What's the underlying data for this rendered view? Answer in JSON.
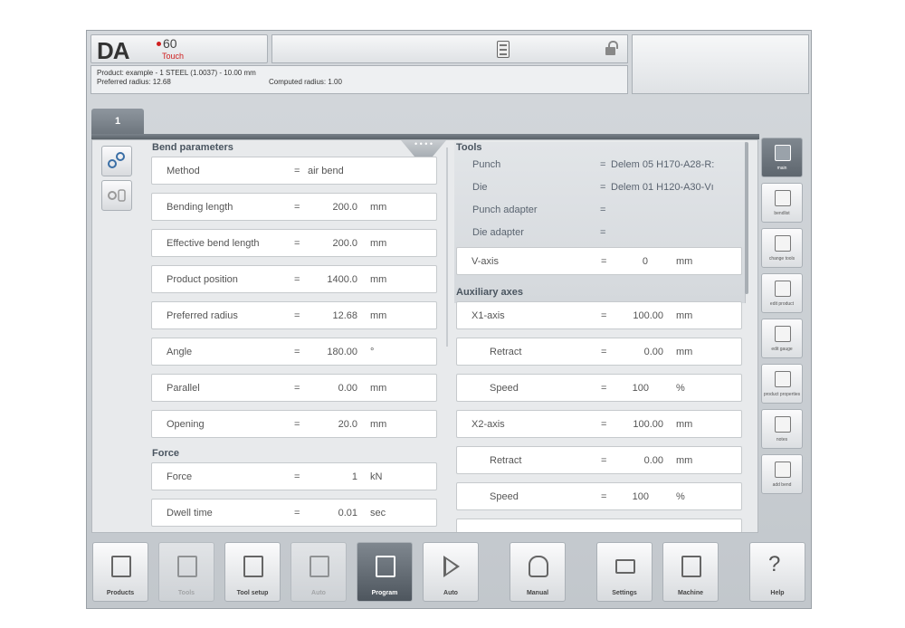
{
  "header": {
    "logo_brand": "DA",
    "logo_model": "60",
    "logo_touch": "Touch",
    "product_line": "Product: example - 1 STEEL (1.0037) - 10.00 mm",
    "preferred_radius": "Preferred radius: 12.68",
    "computed_radius": "Computed radius: 1.00"
  },
  "tab": {
    "label": "1"
  },
  "bend": {
    "title": "Bend parameters",
    "rows": [
      {
        "label": "Method",
        "eq": "=",
        "value": "air bend",
        "unit": ""
      },
      {
        "label": "Bending length",
        "eq": "=",
        "value": "200.0",
        "unit": "mm"
      },
      {
        "label": "Effective bend length",
        "eq": "=",
        "value": "200.0",
        "unit": "mm"
      },
      {
        "label": "Product position",
        "eq": "=",
        "value": "1400.0",
        "unit": "mm"
      },
      {
        "label": "Preferred radius",
        "eq": "=",
        "value": "12.68",
        "unit": "mm"
      },
      {
        "label": "Angle",
        "eq": "=",
        "value": "180.00",
        "unit": "°"
      },
      {
        "label": "Parallel",
        "eq": "=",
        "value": "0.00",
        "unit": "mm"
      },
      {
        "label": "Opening",
        "eq": "=",
        "value": "20.0",
        "unit": "mm"
      }
    ]
  },
  "force": {
    "title": "Force",
    "rows": [
      {
        "label": "Force",
        "eq": "=",
        "value": "1",
        "unit": "kN"
      },
      {
        "label": "Dwell time",
        "eq": "=",
        "value": "0.01",
        "unit": "sec"
      }
    ]
  },
  "tools": {
    "title": "Tools",
    "rows": [
      {
        "label": "Punch",
        "eq": "=",
        "value": "Delem 05 H170-A28-R:"
      },
      {
        "label": "Die",
        "eq": "=",
        "value": "Delem 01 H120-A30-Vı"
      },
      {
        "label": "Punch adapter",
        "eq": "=",
        "value": ""
      },
      {
        "label": "Die adapter",
        "eq": "=",
        "value": ""
      }
    ],
    "vaxis": {
      "label": "V-axis",
      "eq": "=",
      "value": "0",
      "unit": "mm"
    }
  },
  "aux": {
    "title": "Auxiliary axes",
    "rows": [
      {
        "label": "X1-axis",
        "eq": "=",
        "value": "100.00",
        "unit": "mm"
      },
      {
        "label": "Retract",
        "eq": "=",
        "value": "0.00",
        "unit": "mm"
      },
      {
        "label": "Speed",
        "eq": "=",
        "value": "100",
        "unit": "%"
      },
      {
        "label": "X2-axis",
        "eq": "=",
        "value": "100.00",
        "unit": "mm"
      },
      {
        "label": "Retract",
        "eq": "=",
        "value": "0.00",
        "unit": "mm"
      },
      {
        "label": "Speed",
        "eq": "=",
        "value": "100",
        "unit": "%"
      }
    ]
  },
  "sidebar": {
    "items": [
      {
        "label": "main",
        "icon": "main-view-icon"
      },
      {
        "label": "bendlist",
        "icon": "table-icon"
      },
      {
        "label": "change tools",
        "icon": "tools-icon"
      },
      {
        "label": "edit product",
        "icon": "product-icon"
      },
      {
        "label": "edit gauge",
        "icon": "gauge-icon"
      },
      {
        "label": "product properties",
        "icon": "properties-icon"
      },
      {
        "label": "notes",
        "icon": "notes-icon"
      },
      {
        "label": "add bend",
        "icon": "add-bend-icon"
      }
    ]
  },
  "toolbar": {
    "items": [
      {
        "label": "Products",
        "icon": "folder-icon"
      },
      {
        "label": "Tools",
        "icon": "tools-icon"
      },
      {
        "label": "Tool setup",
        "icon": "tool-setup-icon"
      },
      {
        "label": "Auto",
        "icon": "auto-icon"
      },
      {
        "label": "Program",
        "icon": "program-icon"
      },
      {
        "label": "Auto",
        "icon": "play-icon"
      },
      {
        "label": "Manual",
        "icon": "hand-icon"
      },
      {
        "label": "Settings",
        "icon": "settings-icon"
      },
      {
        "label": "Machine",
        "icon": "machine-icon"
      },
      {
        "label": "Help",
        "icon": "help-icon"
      }
    ]
  }
}
